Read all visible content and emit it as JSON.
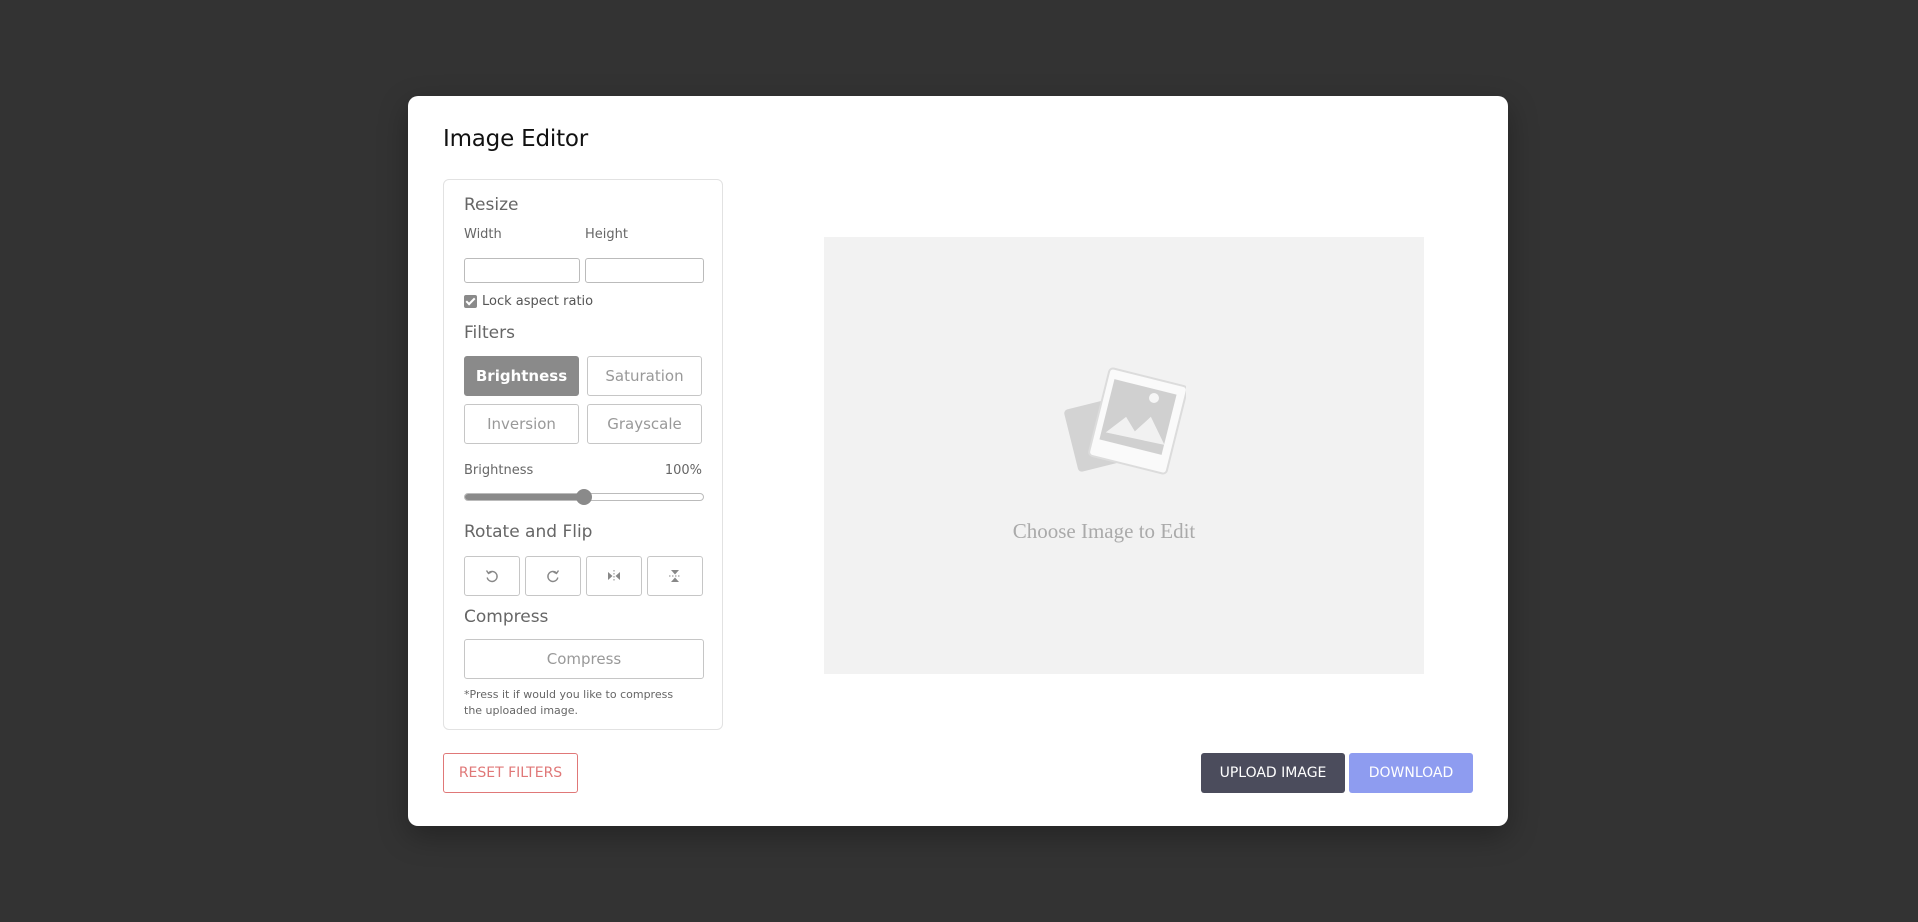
{
  "app": {
    "title": "Image Editor"
  },
  "resize": {
    "heading": "Resize",
    "width_label": "Width",
    "width_value": "",
    "height_label": "Height",
    "height_value": "",
    "lock_label": "Lock aspect ratio",
    "lock_checked": true
  },
  "filters": {
    "heading": "Filters",
    "buttons": [
      {
        "label": "Brightness",
        "active": true
      },
      {
        "label": "Saturation",
        "active": false
      },
      {
        "label": "Inversion",
        "active": false
      },
      {
        "label": "Grayscale",
        "active": false
      }
    ],
    "slider": {
      "label": "Brightness",
      "value_text": "100%",
      "position_fraction": 0.5
    }
  },
  "rotate": {
    "heading": "Rotate and Flip",
    "buttons": [
      {
        "icon": "rotate-left-icon"
      },
      {
        "icon": "rotate-right-icon"
      },
      {
        "icon": "flip-horizontal-icon"
      },
      {
        "icon": "flip-vertical-icon"
      }
    ]
  },
  "compress": {
    "heading": "Compress",
    "button_label": "Compress",
    "note": "*Press it if would you like to compress the uploaded image."
  },
  "preview": {
    "placeholder": "Choose Image to Edit",
    "icon": "image-placeholder-icon"
  },
  "actions": {
    "reset_label": "RESET FILTERS",
    "upload_label": "UPLOAD IMAGE",
    "download_label": "DOWNLOAD"
  },
  "colors": {
    "background": "#333333",
    "accent_gray": "#8a8a8a",
    "reset_red": "#e07878",
    "upload_dark": "#4b4c5c",
    "download_blue": "#8e9cf0"
  }
}
